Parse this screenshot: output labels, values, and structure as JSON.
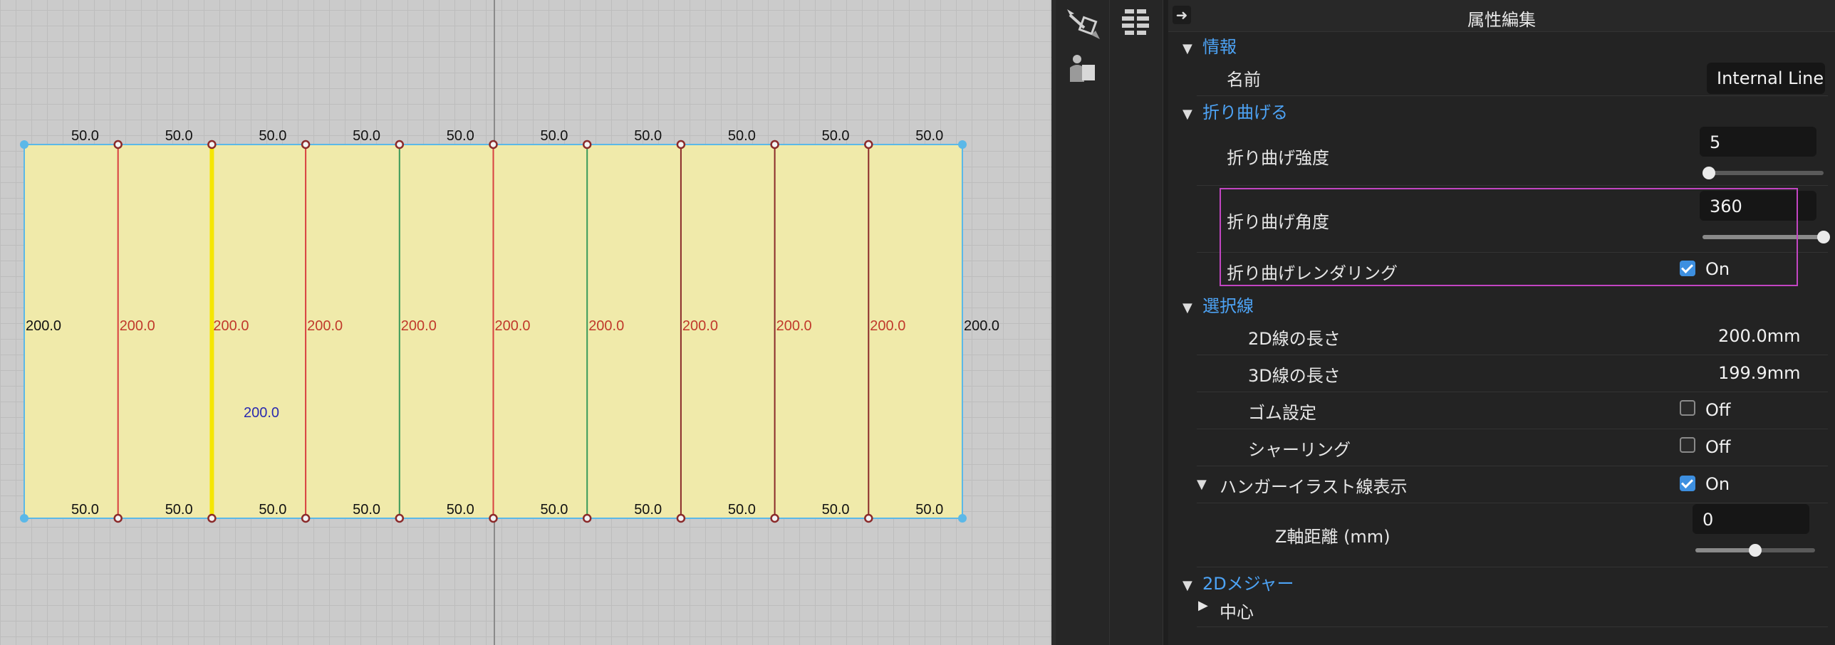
{
  "canvas": {
    "top_labels": [
      "50.0",
      "50.0",
      "50.0",
      "50.0",
      "50.0",
      "50.0",
      "50.0",
      "50.0",
      "50.0",
      "50.0"
    ],
    "bottom_labels": [
      "50.0",
      "50.0",
      "50.0",
      "50.0",
      "50.0",
      "50.0",
      "50.0",
      "50.0",
      "50.0",
      "50.0"
    ],
    "left_edge_label": "200.0",
    "right_edge_label": "200.0",
    "inner_line_labels": [
      "200.0",
      "200.0",
      "200.0",
      "200.0",
      "200.0",
      "200.0",
      "200.0",
      "200.0",
      "200.0"
    ],
    "selected_line_label": "200.0",
    "colors": {
      "fill": "#f0eaaa",
      "edge": "#5bb8e8",
      "fold": "#d84040",
      "selected": "#f5e600",
      "green": "#3a9a5a",
      "dark": "#8a2a2a",
      "label_red": "#c0392b",
      "label_blue": "#2a2ab0"
    }
  },
  "toolstrip": {
    "icons": [
      "measure-tool-icon",
      "avatar-tool-icon",
      "layers-stack-icon"
    ]
  },
  "panel": {
    "title": "属性編集",
    "sections": {
      "info": {
        "header": "情報",
        "name_label": "名前",
        "name_value": "Internal Line"
      },
      "fold": {
        "header": "折り曲げる",
        "strength_label": "折り曲げ強度",
        "strength_value": "5",
        "strength_fraction": 0.05,
        "angle_label": "折り曲げ角度",
        "angle_value": "360",
        "angle_fraction": 1.0,
        "rendering_label": "折り曲げレンダリング",
        "rendering_value": "On"
      },
      "selection": {
        "header": "選択線",
        "len2d_label": "2D線の長さ",
        "len2d_value": "200.0mm",
        "len3d_label": "3D線の長さ",
        "len3d_value": "199.9mm",
        "rubber_label": "ゴム設定",
        "rubber_value": "Off",
        "shirring_label": "シャーリング",
        "shirring_value": "Off",
        "hanger_label": "ハンガーイラスト線表示",
        "hanger_value": "On",
        "zdist_label": "Z軸距離 (mm)",
        "zdist_value": "0",
        "zdist_fraction": 0.5
      },
      "measure": {
        "header": "2Dメジャー",
        "center_label": "中心"
      }
    }
  }
}
